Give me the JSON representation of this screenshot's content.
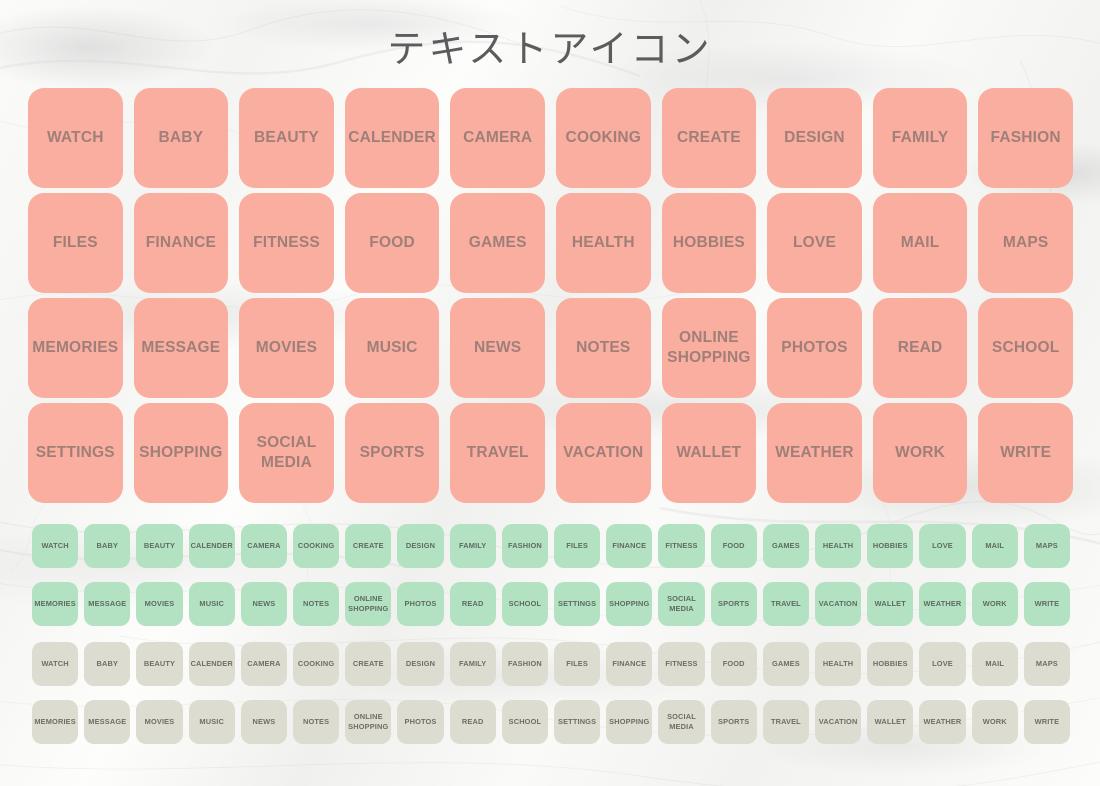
{
  "page": {
    "title": "テキストアイコン",
    "background": "marble-texture",
    "background_color": "#f7f7f5"
  },
  "palette": {
    "salmon": "#f9aea0",
    "salmon_text": "#a17f79",
    "green": "#b2e2c2",
    "green_text": "#5f6b62",
    "beige": "#dcdcd1",
    "beige_text": "#6e6e66",
    "title_text": "#5c5c5c"
  },
  "labels": [
    "WATCH",
    "BABY",
    "BEAUTY",
    "CALENDER",
    "CAMERA",
    "COOKING",
    "CREATE",
    "DESIGN",
    "FAMILY",
    "FASHION",
    "FILES",
    "FINANCE",
    "FITNESS",
    "FOOD",
    "GAMES",
    "HEALTH",
    "HOBBIES",
    "LOVE",
    "MAIL",
    "MAPS",
    "MEMORIES",
    "MESSAGE",
    "MOVIES",
    "MUSIC",
    "NEWS",
    "NOTES",
    "ONLINE\nSHOPPING",
    "PHOTOS",
    "READ",
    "SCHOOL",
    "SETTINGS",
    "SHOPPING",
    "SOCIAL\nMEDIA",
    "SPORTS",
    "TRAVEL",
    "VACATION",
    "WALLET",
    "WEATHER",
    "WORK",
    "WRITE"
  ],
  "grids": [
    {
      "id": "grid-big",
      "name": "large-salmon-icon-grid",
      "variant": "big",
      "color": "#f9aea0",
      "columns": 10,
      "rows": 4,
      "count": 40
    },
    {
      "id": "grid-green",
      "name": "small-green-icon-grid",
      "variant": "green",
      "color": "#b2e2c2",
      "columns": 20,
      "rows": 2,
      "count": 40
    },
    {
      "id": "grid-beige",
      "name": "small-beige-icon-grid",
      "variant": "beige",
      "color": "#dcdcd1",
      "columns": 20,
      "rows": 2,
      "count": 40
    }
  ]
}
